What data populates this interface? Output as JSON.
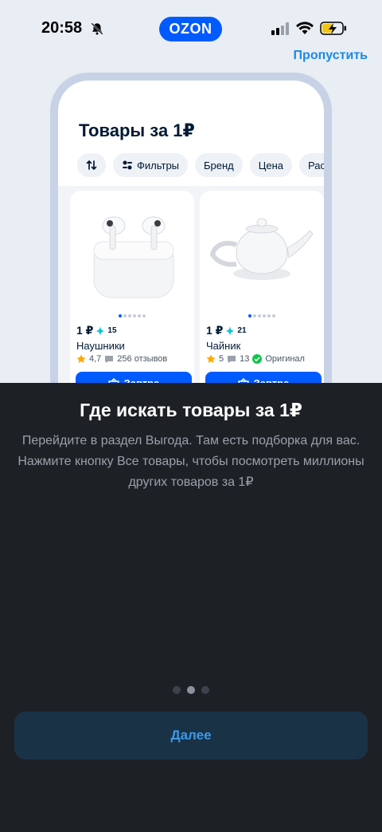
{
  "status": {
    "time": "20:58"
  },
  "header": {
    "logo": "OZON",
    "skip_label": "Пропустить"
  },
  "mockup": {
    "title": "Товары за 1₽",
    "chips": [
      {
        "icon": "sort-icon",
        "label": ""
      },
      {
        "icon": "filter-icon",
        "label": "Фильтры"
      },
      {
        "icon": "",
        "label": "Бренд"
      },
      {
        "icon": "",
        "label": "Цена"
      },
      {
        "icon": "",
        "label": "Распро"
      }
    ],
    "products": [
      {
        "price": "1 ₽",
        "bonus": "15",
        "name": "Наушники",
        "rating": "4,7",
        "reviews": "256 отзывов",
        "badge": "",
        "button": "Завтра"
      },
      {
        "price": "1 ₽",
        "bonus": "21",
        "name": "Чайник",
        "rating": "5",
        "reviews": "13",
        "badge": "Оригинал",
        "button": "Завтра"
      }
    ]
  },
  "sheet": {
    "title": "Где искать товары за 1₽",
    "text": "Перейдите в раздел Выгода. Там есть подборка для вас. Нажмите кнопку Все товары, чтобы посмотреть миллионы других товаров за 1₽",
    "pager": {
      "total": 3,
      "active": 2
    },
    "next_label": "Далее"
  },
  "colors": {
    "accent": "#005bff",
    "sheet_bg": "#1d2126",
    "skip": "#1a8ae6"
  }
}
